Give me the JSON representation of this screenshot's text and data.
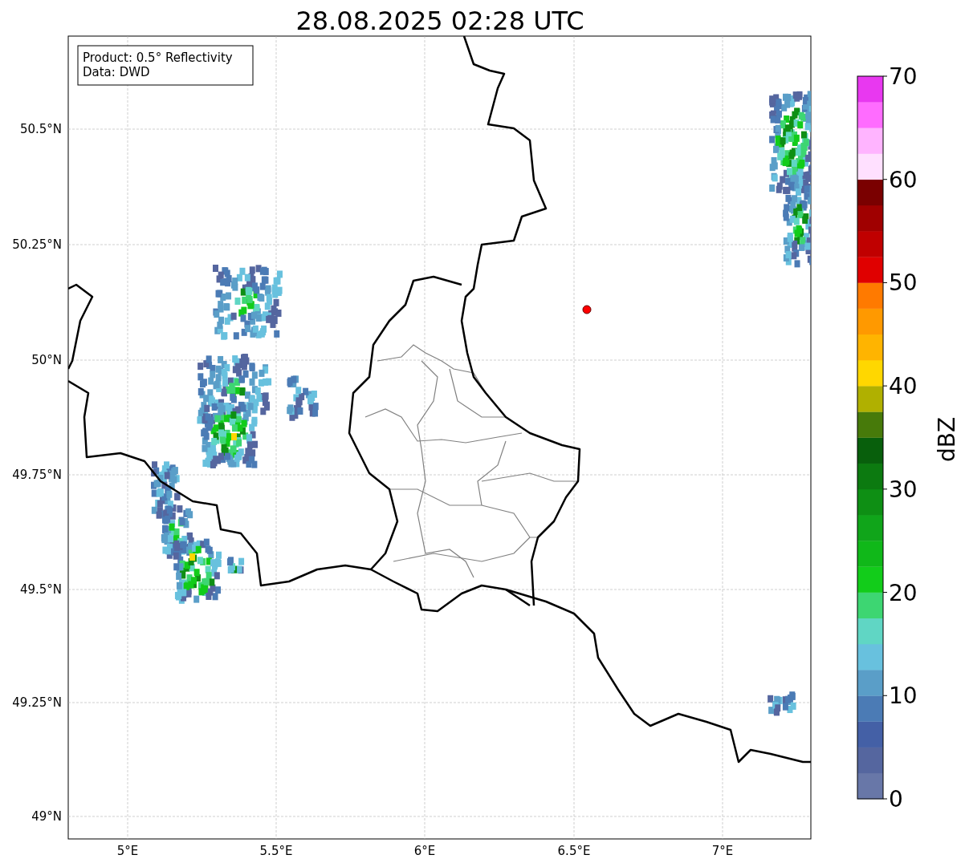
{
  "title": "28.08.2025 02:28 UTC",
  "info_box": [
    "Product: 0.5° Reflectivity",
    "Data: DWD"
  ],
  "y_ticks": [
    "50.5°N",
    "50.25°N",
    "50°N",
    "49.75°N",
    "49.5°N",
    "49.25°N",
    "49°N"
  ],
  "x_ticks": [
    "5°E",
    "5.5°E",
    "6°E",
    "6.5°E",
    "7°E"
  ],
  "colorbar": {
    "label": "dBZ",
    "ticks": [
      "70",
      "60",
      "50",
      "40",
      "30",
      "20",
      "10",
      "0"
    ],
    "bands": [
      {
        "color": "#6877a8"
      },
      {
        "color": "#55669f"
      },
      {
        "color": "#4460a6"
      },
      {
        "color": "#4b7bb5"
      },
      {
        "color": "#5a9ec8"
      },
      {
        "color": "#68c1de"
      },
      {
        "color": "#60d6c4"
      },
      {
        "color": "#3dd672"
      },
      {
        "color": "#12cc1a"
      },
      {
        "color": "#10b819"
      },
      {
        "color": "#10a51a"
      },
      {
        "color": "#0e8f14"
      },
      {
        "color": "#0c7a10"
      },
      {
        "color": "#085f0c"
      },
      {
        "color": "#477a0a"
      },
      {
        "color": "#b0b000"
      },
      {
        "color": "#ffd700"
      },
      {
        "color": "#ffb400"
      },
      {
        "color": "#ff9900"
      },
      {
        "color": "#ff7a00"
      },
      {
        "color": "#e00000"
      },
      {
        "color": "#c00000"
      },
      {
        "color": "#a00000"
      },
      {
        "color": "#7a0000"
      },
      {
        "color": "#ffe0ff"
      },
      {
        "color": "#ffb4ff"
      },
      {
        "color": "#ff6cff"
      },
      {
        "color": "#e838f0"
      }
    ]
  }
}
